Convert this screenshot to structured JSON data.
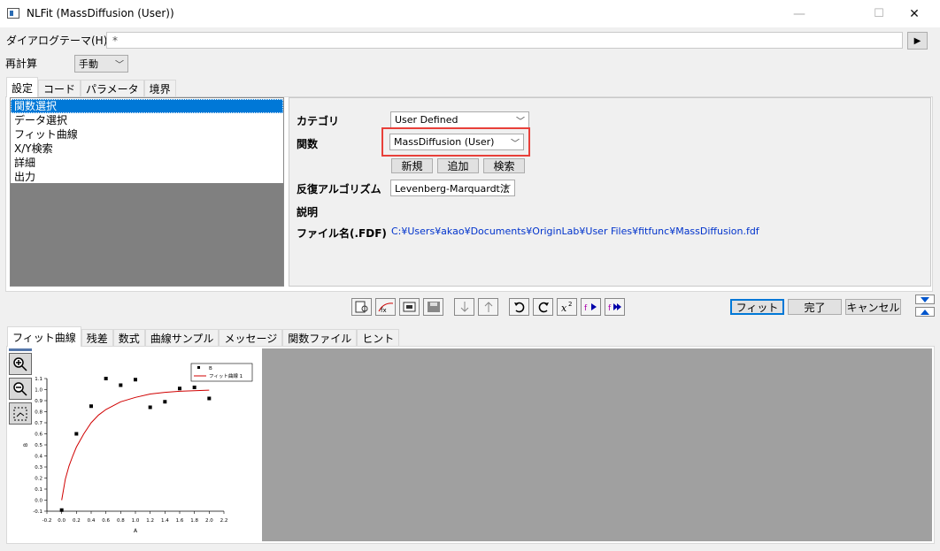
{
  "window": {
    "title": "NLFit (MassDiffusion (User))",
    "minimize": "—",
    "maximize": "☐",
    "close": "✕"
  },
  "theme": {
    "label": "ダイアログテーマ(H)",
    "value": "*",
    "play": "▶"
  },
  "recalc": {
    "label": "再計算",
    "value": "手動"
  },
  "top_tabs": [
    "設定",
    "コード",
    "パラメータ",
    "境界"
  ],
  "settings_list": [
    "関数選択",
    "データ選択",
    "フィット曲線",
    "X/Y検索",
    "詳細",
    "出力"
  ],
  "function_panel": {
    "category_label": "カテゴリ",
    "category_value": "User Defined",
    "function_label": "関数",
    "function_value": "MassDiffusion (User)",
    "new_button": "新規",
    "add_button": "追加",
    "search_button": "検索",
    "algorithm_label": "反復アルゴリズム",
    "algorithm_value": "Levenberg-Marquardt法",
    "description_label": "説明",
    "filename_label": "ファイル名(.FDF)",
    "filename_value": "C:¥Users¥akao¥Documents¥OriginLab¥User Files¥fitfunc¥MassDiffusion.fdf"
  },
  "actions": {
    "fit": "フィット",
    "done": "完了",
    "cancel": "キャンセル"
  },
  "bottom_tabs": [
    "フィット曲線",
    "残差",
    "数式",
    "曲線サンプル",
    "メッセージ",
    "関数ファイル",
    "ヒント"
  ],
  "highlight_color": "#e8403a",
  "accent_color": "#0078d7",
  "chart_data": {
    "type": "scatter",
    "xlabel": "A",
    "ylabel": "B",
    "xlim": [
      -0.2,
      2.2
    ],
    "ylim": [
      -0.1,
      1.1
    ],
    "xticks": [
      "-0.2",
      "0.0",
      "0.2",
      "0.4",
      "0.6",
      "0.8",
      "1.0",
      "1.2",
      "1.4",
      "1.6",
      "1.8",
      "2.0",
      "2.2"
    ],
    "yticks": [
      "-0.1",
      "0.0",
      "0.1",
      "0.2",
      "0.3",
      "0.4",
      "0.5",
      "0.6",
      "0.7",
      "0.8",
      "0.9",
      "1.0",
      "1.1"
    ],
    "legend": [
      "B",
      "フィット曲線 1"
    ],
    "series": [
      {
        "name": "B",
        "x": [
          0.0,
          0.2,
          0.4,
          0.6,
          0.8,
          1.0,
          1.2,
          1.4,
          1.6,
          1.8,
          2.0
        ],
        "y": [
          -0.09,
          0.6,
          0.85,
          1.1,
          1.04,
          1.09,
          0.84,
          0.89,
          1.01,
          1.02,
          0.92
        ]
      },
      {
        "name": "フィット曲線 1",
        "x": [
          0.0,
          0.05,
          0.1,
          0.15,
          0.2,
          0.3,
          0.4,
          0.5,
          0.6,
          0.8,
          1.0,
          1.2,
          1.4,
          1.6,
          1.8,
          2.0
        ],
        "y": [
          0.0,
          0.19,
          0.31,
          0.4,
          0.48,
          0.6,
          0.7,
          0.77,
          0.82,
          0.89,
          0.93,
          0.96,
          0.975,
          0.985,
          0.99,
          0.995
        ]
      }
    ]
  }
}
